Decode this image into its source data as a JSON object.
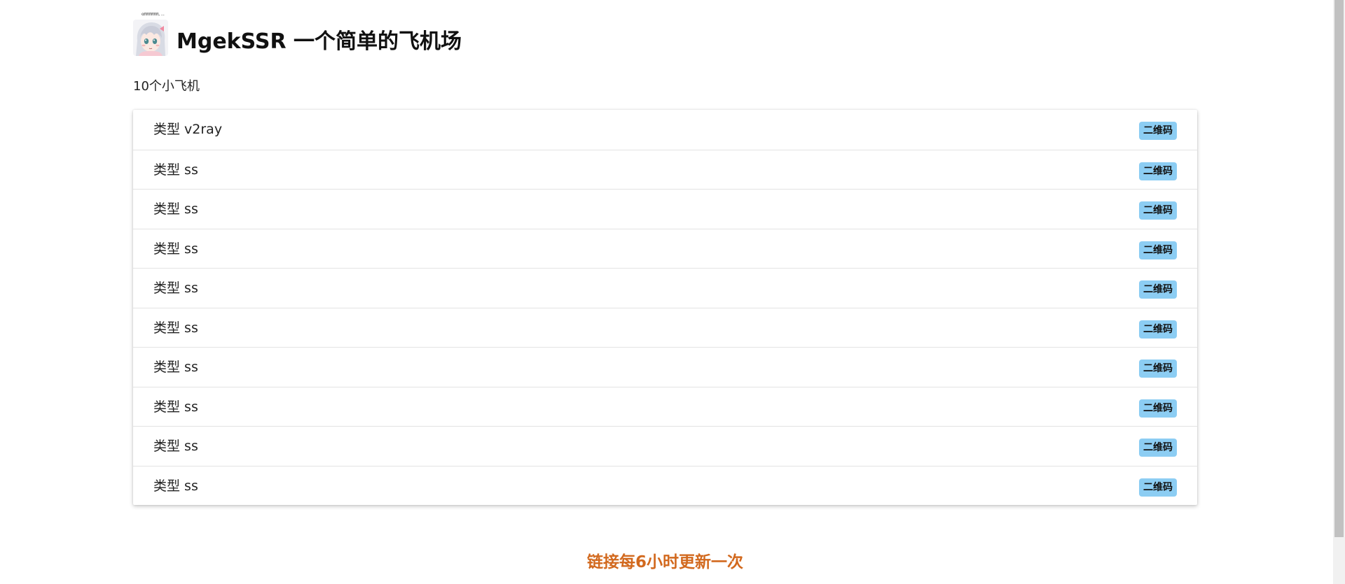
{
  "header": {
    "avatar_caption": "αππππππ, ...",
    "title": "MgekSSR 一个简单的飞机场"
  },
  "summary": {
    "count_text": "10个小飞机"
  },
  "servers": [
    {
      "type_text": "类型 v2ray",
      "qr_label": "二维码"
    },
    {
      "type_text": "类型 ss",
      "qr_label": "二维码"
    },
    {
      "type_text": "类型 ss",
      "qr_label": "二维码"
    },
    {
      "type_text": "类型 ss",
      "qr_label": "二维码"
    },
    {
      "type_text": "类型 ss",
      "qr_label": "二维码"
    },
    {
      "type_text": "类型 ss",
      "qr_label": "二维码"
    },
    {
      "type_text": "类型 ss",
      "qr_label": "二维码"
    },
    {
      "type_text": "类型 ss",
      "qr_label": "二维码"
    },
    {
      "type_text": "类型 ss",
      "qr_label": "二维码"
    },
    {
      "type_text": "类型 ss",
      "qr_label": "二维码"
    }
  ],
  "footer": {
    "note": "链接每6小时更新一次"
  },
  "colors": {
    "qr_button_bg": "#8ccdf3",
    "footer_note": "#d2691e"
  },
  "icons": {
    "avatar": "anime-girl-avatar"
  }
}
